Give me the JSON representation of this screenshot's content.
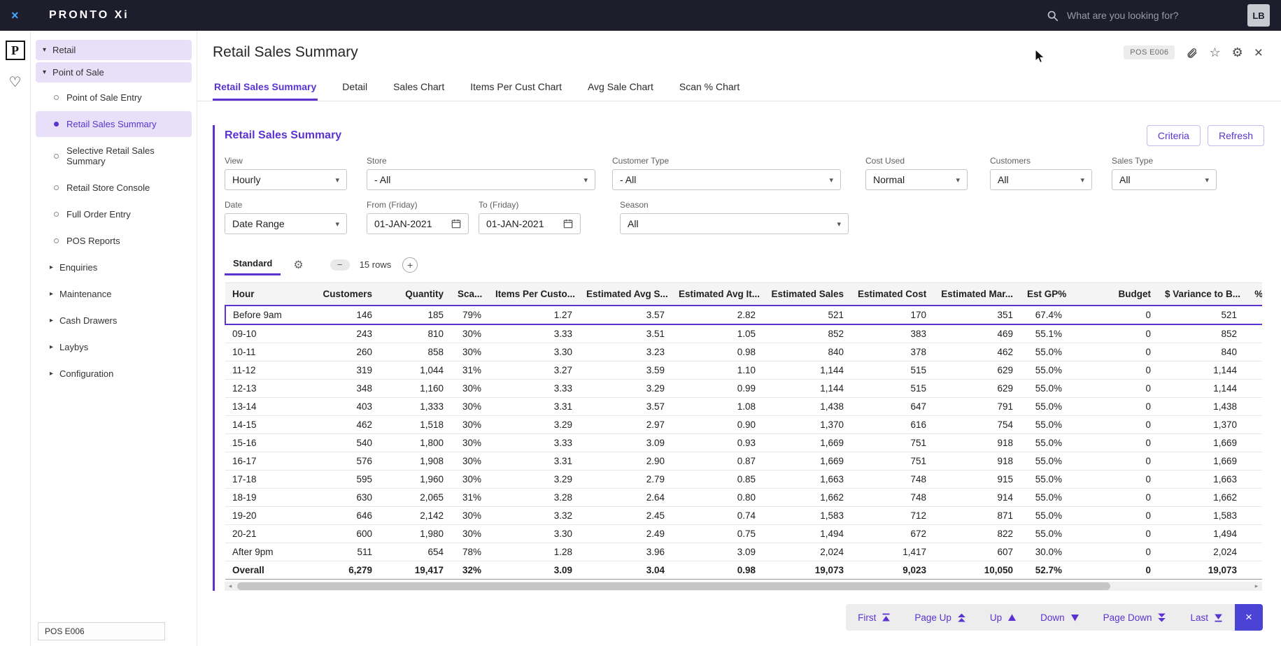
{
  "colors": {
    "accent": "#5b33d1",
    "topbar_bg": "#1d1d2b",
    "lavender": "#e7e0f8",
    "pager_close_bg": "#4a43d6"
  },
  "topbar": {
    "logo": "PRONTO Xi",
    "search_placeholder": "What are you looking for?",
    "avatar_initials": "LB"
  },
  "rail": {
    "product_initial": "P"
  },
  "sidebar": {
    "section_retail": "Retail",
    "section_pos": "Point of Sale",
    "items": [
      {
        "label": "Point of Sale Entry"
      },
      {
        "label": "Retail Sales Summary"
      },
      {
        "label": "Selective Retail Sales Summary"
      },
      {
        "label": "Retail Store Console"
      },
      {
        "label": "Full Order Entry"
      },
      {
        "label": "POS Reports"
      }
    ],
    "groups": [
      {
        "label": "Enquiries"
      },
      {
        "label": "Maintenance"
      },
      {
        "label": "Cash Drawers"
      },
      {
        "label": "Laybys"
      },
      {
        "label": "Configuration"
      }
    ],
    "footer_code": "POS E006"
  },
  "header": {
    "title": "Retail Sales Summary",
    "code_badge": "POS E006"
  },
  "tabs": [
    {
      "label": "Retail Sales Summary"
    },
    {
      "label": "Detail"
    },
    {
      "label": "Sales Chart"
    },
    {
      "label": "Items Per Cust Chart"
    },
    {
      "label": "Avg Sale Chart"
    },
    {
      "label": "Scan % Chart"
    }
  ],
  "panel": {
    "title": "Retail Sales Summary",
    "criteria_label": "Criteria",
    "refresh_label": "Refresh",
    "filters_row1": [
      {
        "label": "View",
        "value": "Hourly"
      },
      {
        "label": "Store",
        "value": "- All"
      },
      {
        "label": "Customer Type",
        "value": "- All"
      },
      {
        "label": "Cost Used",
        "value": "Normal"
      },
      {
        "label": "Customers",
        "value": "All"
      },
      {
        "label": "Sales Type",
        "value": "All"
      }
    ],
    "filters_row2": [
      {
        "label": "Date",
        "value": "Date Range"
      },
      {
        "label": "From (Friday)",
        "value": "01-JAN-2021"
      },
      {
        "label": "To (Friday)",
        "value": "01-JAN-2021"
      },
      {
        "label": "Season",
        "value": "All"
      }
    ]
  },
  "grid": {
    "view_label": "Standard",
    "rows_label": "15 rows",
    "columns": [
      "Hour",
      "Customers",
      "Quantity",
      "Sca...",
      "Items Per Custo...",
      "Estimated Avg S...",
      "Estimated Avg It...",
      "Estimated Sales",
      "Estimated Cost",
      "Estimated Mar...",
      "Est GP%",
      "Budget",
      "$ Variance to B...",
      "% V..."
    ],
    "selected_row_index": 0,
    "rows": [
      [
        "Before 9am",
        "146",
        "185",
        "79%",
        "1.27",
        "3.57",
        "2.82",
        "521",
        "170",
        "351",
        "67.4%",
        "0",
        "521",
        ""
      ],
      [
        "09-10",
        "243",
        "810",
        "30%",
        "3.33",
        "3.51",
        "1.05",
        "852",
        "383",
        "469",
        "55.1%",
        "0",
        "852",
        ""
      ],
      [
        "10-11",
        "260",
        "858",
        "30%",
        "3.30",
        "3.23",
        "0.98",
        "840",
        "378",
        "462",
        "55.0%",
        "0",
        "840",
        ""
      ],
      [
        "11-12",
        "319",
        "1,044",
        "31%",
        "3.27",
        "3.59",
        "1.10",
        "1,144",
        "515",
        "629",
        "55.0%",
        "0",
        "1,144",
        ""
      ],
      [
        "12-13",
        "348",
        "1,160",
        "30%",
        "3.33",
        "3.29",
        "0.99",
        "1,144",
        "515",
        "629",
        "55.0%",
        "0",
        "1,144",
        ""
      ],
      [
        "13-14",
        "403",
        "1,333",
        "30%",
        "3.31",
        "3.57",
        "1.08",
        "1,438",
        "647",
        "791",
        "55.0%",
        "0",
        "1,438",
        ""
      ],
      [
        "14-15",
        "462",
        "1,518",
        "30%",
        "3.29",
        "2.97",
        "0.90",
        "1,370",
        "616",
        "754",
        "55.0%",
        "0",
        "1,370",
        ""
      ],
      [
        "15-16",
        "540",
        "1,800",
        "30%",
        "3.33",
        "3.09",
        "0.93",
        "1,669",
        "751",
        "918",
        "55.0%",
        "0",
        "1,669",
        ""
      ],
      [
        "16-17",
        "576",
        "1,908",
        "30%",
        "3.31",
        "2.90",
        "0.87",
        "1,669",
        "751",
        "918",
        "55.0%",
        "0",
        "1,669",
        ""
      ],
      [
        "17-18",
        "595",
        "1,960",
        "30%",
        "3.29",
        "2.79",
        "0.85",
        "1,663",
        "748",
        "915",
        "55.0%",
        "0",
        "1,663",
        ""
      ],
      [
        "18-19",
        "630",
        "2,065",
        "31%",
        "3.28",
        "2.64",
        "0.80",
        "1,662",
        "748",
        "914",
        "55.0%",
        "0",
        "1,662",
        ""
      ],
      [
        "19-20",
        "646",
        "2,142",
        "30%",
        "3.32",
        "2.45",
        "0.74",
        "1,583",
        "712",
        "871",
        "55.0%",
        "0",
        "1,583",
        ""
      ],
      [
        "20-21",
        "600",
        "1,980",
        "30%",
        "3.30",
        "2.49",
        "0.75",
        "1,494",
        "672",
        "822",
        "55.0%",
        "0",
        "1,494",
        ""
      ],
      [
        "After 9pm",
        "511",
        "654",
        "78%",
        "1.28",
        "3.96",
        "3.09",
        "2,024",
        "1,417",
        "607",
        "30.0%",
        "0",
        "2,024",
        ""
      ]
    ],
    "overall": [
      "Overall",
      "6,279",
      "19,417",
      "32%",
      "3.09",
      "3.04",
      "0.98",
      "19,073",
      "9,023",
      "10,050",
      "52.7%",
      "0",
      "19,073",
      ""
    ]
  },
  "pager": {
    "buttons": [
      {
        "label": "First"
      },
      {
        "label": "Page Up"
      },
      {
        "label": "Up"
      },
      {
        "label": "Down"
      },
      {
        "label": "Page Down"
      },
      {
        "label": "Last"
      }
    ]
  }
}
